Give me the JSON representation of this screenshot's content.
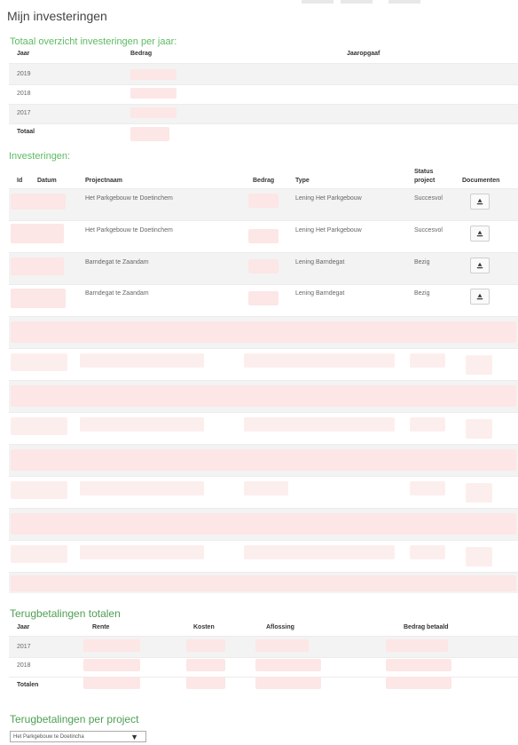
{
  "page": {
    "title": "Mijn investeringen"
  },
  "totals_section": {
    "title": "Totaal overzicht investeringen per jaar:",
    "headers": {
      "jaar": "Jaar",
      "bedrag": "Bedrag",
      "jaaropgaaf": "Jaaropgaaf"
    },
    "rows": [
      {
        "jaar": "2019"
      },
      {
        "jaar": "2018"
      },
      {
        "jaar": "2017"
      },
      {
        "jaar": "Totaal"
      }
    ]
  },
  "investments_section": {
    "title": "Investeringen:",
    "headers": {
      "id": "Id",
      "datum": "Datum",
      "projectnaam": "Projectnaam",
      "bedrag": "Bedrag",
      "type": "Type",
      "status_line1": "Status",
      "status_line2": "project",
      "documenten": "Documenten"
    },
    "rows": [
      {
        "projectnaam": "Het Parkgebouw te Doetinchem",
        "type": "Lening Het Parkgebouw",
        "status": "Succesvol"
      },
      {
        "projectnaam": "Het Parkgebouw te Doetinchem",
        "type": "Lening Het Parkgebouw",
        "status": "Succesvol"
      },
      {
        "projectnaam": "Barndegat te Zaandam",
        "type": "Lening Barndegat",
        "status": "Bezig"
      },
      {
        "projectnaam": "Barndegat te Zaandam",
        "type": "Lening Barndegat",
        "status": "Bezig"
      }
    ],
    "download_icon": "download-icon"
  },
  "repayments_totals": {
    "title": "Terugbetalingen totalen",
    "headers": {
      "jaar": "Jaar",
      "rente": "Rente",
      "kosten": "Kosten",
      "aflossing": "Aflossing",
      "bedrag_betaald": "Bedrag betaald"
    },
    "rows": [
      {
        "jaar": "2017"
      },
      {
        "jaar": "2018"
      },
      {
        "jaar": "Totalen"
      }
    ]
  },
  "repayments_project": {
    "title": "Terugbetalingen per project",
    "select_value": "Het Parkgebouw te Doetincha"
  },
  "colors": {
    "accent_green": "#5dbb63",
    "redaction": "#fde6e6"
  }
}
